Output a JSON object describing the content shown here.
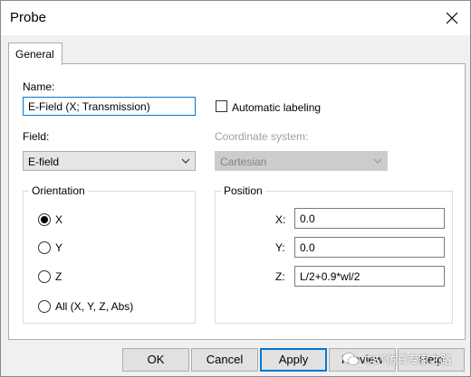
{
  "window": {
    "title": "Probe"
  },
  "tabs": [
    {
      "label": "General"
    }
  ],
  "name": {
    "label": "Name:",
    "value": "E-Field (X; Transmission)"
  },
  "auto_labeling": {
    "label": "Automatic labeling",
    "checked": false
  },
  "field": {
    "label": "Field:",
    "selected": "E-field"
  },
  "coordinate_system": {
    "label": "Coordinate system:",
    "selected": "Cartesian",
    "disabled": true
  },
  "orientation": {
    "title": "Orientation",
    "options": [
      {
        "label": "X",
        "checked": true
      },
      {
        "label": "Y",
        "checked": false
      },
      {
        "label": "Z",
        "checked": false
      },
      {
        "label": "All (X, Y, Z, Abs)",
        "checked": false
      }
    ]
  },
  "position": {
    "title": "Position",
    "x": {
      "label": "X:",
      "value": "0.0"
    },
    "y": {
      "label": "Y:",
      "value": "0.0"
    },
    "z": {
      "label": "Z:",
      "value": "L/2+0.9*wl/2"
    }
  },
  "buttons": {
    "ok": "OK",
    "cancel": "Cancel",
    "apply": "Apply",
    "preview": "Preview",
    "help": "Help"
  },
  "watermark": {
    "text": "CST仿真专家之路"
  },
  "colors": {
    "focus": "#0078d7",
    "button_bg": "#e1e1e1",
    "disabled_text": "#a0a0a0"
  }
}
